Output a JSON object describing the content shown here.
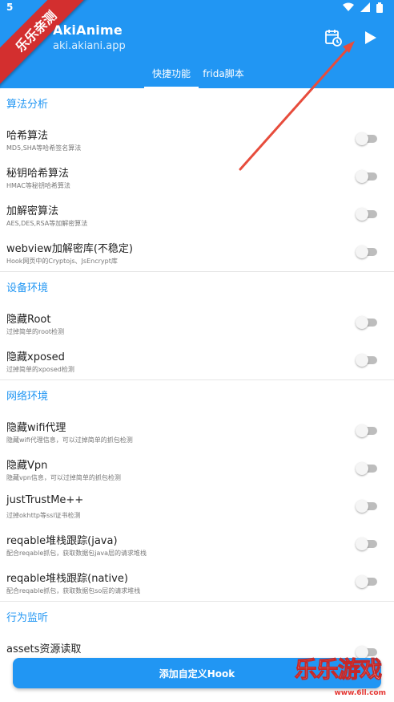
{
  "status": {
    "left": "5",
    "wifi_icon": "wifi-icon",
    "signal_icon": "signal-icon",
    "battery_icon": "battery-icon"
  },
  "app": {
    "title": "AkiAnime",
    "package": "aki.akiani.app"
  },
  "actions": {
    "schedule_icon": "calendar-clock-icon",
    "play_icon": "play-icon"
  },
  "tabs": [
    {
      "label": "快捷功能",
      "active": true
    },
    {
      "label": "frida脚本",
      "active": false
    }
  ],
  "ribbon": {
    "text": "乐乐亲测"
  },
  "sections": [
    {
      "title": "算法分析",
      "items": [
        {
          "title": "哈希算法",
          "sub": "MD5,SHA等哈希签名算法",
          "on": false
        },
        {
          "title": "秘钥哈希算法",
          "sub": "HMAC等秘钥哈希算法",
          "on": false
        },
        {
          "title": "加解密算法",
          "sub": "AES,DES,RSA等加解密算法",
          "on": false
        },
        {
          "title": "webview加解密库(不稳定)",
          "sub": "Hook网页中的Cryptojs、JsEncrypt库",
          "on": false
        }
      ]
    },
    {
      "title": "设备环境",
      "items": [
        {
          "title": "隐藏Root",
          "sub": "过掉简单的root检测",
          "on": false
        },
        {
          "title": "隐藏xposed",
          "sub": "过掉简单的xposed检测",
          "on": false
        }
      ]
    },
    {
      "title": "网络环境",
      "items": [
        {
          "title": "隐藏wifi代理",
          "sub": "隐藏wifi代理信息，可以过掉简单的抓包检测",
          "on": false
        },
        {
          "title": "隐藏Vpn",
          "sub": "隐藏vpn信息，可以过掉简单的抓包检测",
          "on": false
        },
        {
          "title": "justTrustMe++",
          "sub": "过掉okhttp等ssl证书检测",
          "on": false
        },
        {
          "title": "reqable堆栈跟踪(java)",
          "sub": "配合reqable抓包，获取数据包java层的请求堆栈",
          "on": false
        },
        {
          "title": "reqable堆栈跟踪(native)",
          "sub": "配合reqable抓包，获取数据包so层的请求堆栈",
          "on": false
        }
      ]
    },
    {
      "title": "行为监听",
      "items": [
        {
          "title": "assets资源读取",
          "sub": "",
          "on": false
        }
      ]
    }
  ],
  "bottom_button": {
    "label": "添加自定义Hook"
  },
  "watermark": {
    "text": "乐乐游戏",
    "url": "www.6ll.com"
  },
  "colors": {
    "primary": "#2196F3",
    "ribbon": "#d32f2f",
    "arrow": "#e74c3c"
  }
}
